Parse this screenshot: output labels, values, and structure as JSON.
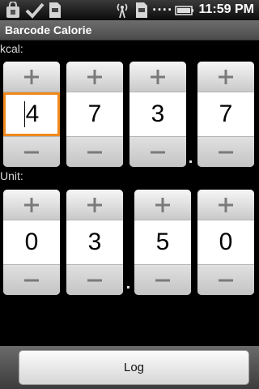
{
  "status_bar": {
    "time": "11:59 PM",
    "dots": "....",
    "icons": [
      "shopping-bag-icon",
      "checkmark-icon",
      "sim-card-icon",
      "signal-broadcast-icon",
      "sim-card-icon",
      "battery-icon"
    ]
  },
  "app": {
    "title": "Barcode Calorie"
  },
  "kcal": {
    "label": "kcal:",
    "digits": [
      "4",
      "7",
      "3",
      "7"
    ],
    "focused_index": 0
  },
  "unit": {
    "label": "Unit:",
    "digits": [
      "0",
      "3",
      "5",
      "0"
    ]
  },
  "actions": {
    "log_label": "Log"
  },
  "colors": {
    "focus_border": "#f08a1e",
    "background": "#000000"
  }
}
